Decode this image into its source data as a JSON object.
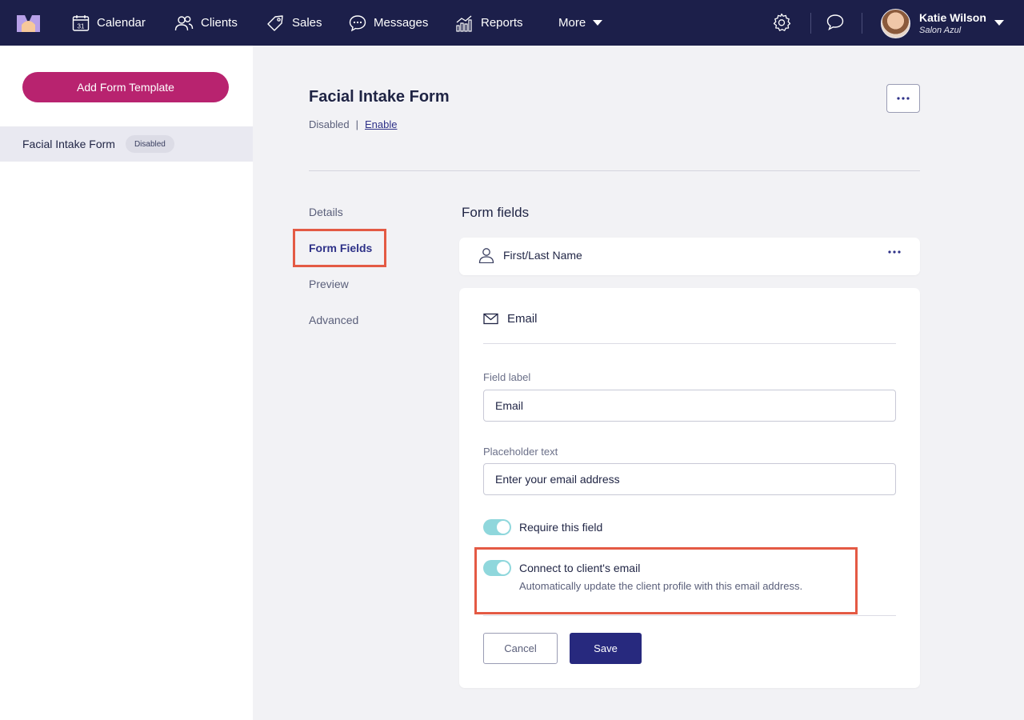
{
  "nav": {
    "items": [
      {
        "label": "Calendar",
        "icon": "calendar-icon"
      },
      {
        "label": "Clients",
        "icon": "clients-icon"
      },
      {
        "label": "Sales",
        "icon": "tag-icon"
      },
      {
        "label": "Messages",
        "icon": "chat-bubble-icon"
      },
      {
        "label": "Reports",
        "icon": "bar-chart-icon"
      },
      {
        "label": "More",
        "icon": "caret-down-icon"
      }
    ],
    "calendar_day": "31",
    "user_name": "Katie Wilson",
    "user_salon": "Salon Azul"
  },
  "sidebar": {
    "add_button": "Add Form Template",
    "items": [
      {
        "label": "Facial Intake Form",
        "badge": "Disabled"
      }
    ]
  },
  "form": {
    "title": "Facial Intake Form",
    "status": "Disabled",
    "separator": "|",
    "enable_link": "Enable"
  },
  "subnav": {
    "items": [
      "Details",
      "Form Fields",
      "Preview",
      "Advanced"
    ],
    "active": "Form Fields"
  },
  "form_fields": {
    "section_title": "Form fields",
    "name_field": "First/Last Name",
    "email_card": {
      "title": "Email",
      "field_label_title": "Field label",
      "field_label_value": "Email",
      "placeholder_title": "Placeholder text",
      "placeholder_value": "Enter your email address",
      "require_label": "Require this field",
      "require_on": true,
      "connect_label": "Connect to client's email",
      "connect_desc": "Automatically update the client profile with this email address.",
      "connect_on": true,
      "cancel": "Cancel",
      "save": "Save"
    }
  },
  "colors": {
    "nav_bg": "#1c1f4a",
    "accent_pink": "#b8236f",
    "accent_navy": "#27297e",
    "toggle_on": "#8fd7dc",
    "highlight": "#e45a44"
  }
}
